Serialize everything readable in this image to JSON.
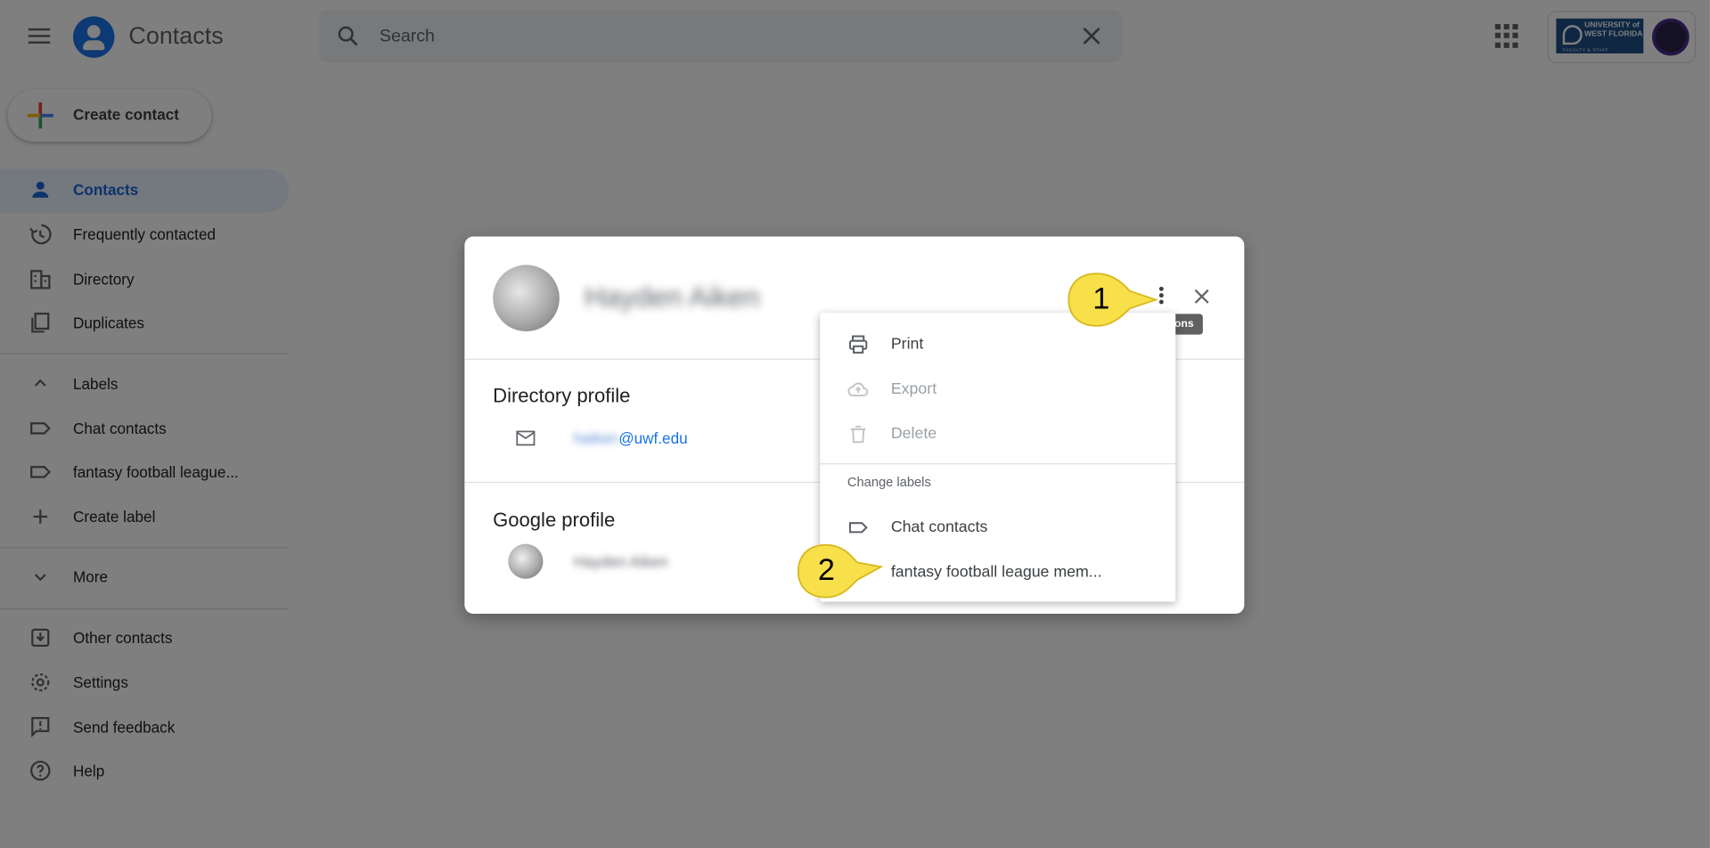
{
  "header": {
    "app_title": "Contacts",
    "search_placeholder": "Search"
  },
  "account": {
    "org_line1": "UNIVERSITY of WEST FLORIDA",
    "org_line2": "FACULTY & STAFF"
  },
  "sidebar": {
    "create_label": "Create contact",
    "items": [
      {
        "label": "Contacts",
        "icon": "person-icon",
        "active": true
      },
      {
        "label": "Frequently contacted",
        "icon": "history-icon"
      },
      {
        "label": "Directory",
        "icon": "building-icon"
      },
      {
        "label": "Duplicates",
        "icon": "duplicate-icon"
      }
    ],
    "labels_header": "Labels",
    "labels": [
      {
        "label": "Chat contacts",
        "icon": "label-icon"
      },
      {
        "label": "fantasy football league...",
        "icon": "label-icon"
      }
    ],
    "create_label_text": "Create label",
    "more_label": "More",
    "footer_items": [
      {
        "label": "Other contacts",
        "icon": "download-box-icon"
      },
      {
        "label": "Settings",
        "icon": "gear-icon"
      },
      {
        "label": "Send feedback",
        "icon": "feedback-icon"
      },
      {
        "label": "Help",
        "icon": "help-icon"
      }
    ]
  },
  "dialog": {
    "contact_name": "Hayden Aiken",
    "tooltip": "More actions",
    "directory_title": "Directory profile",
    "email_user": "haiken",
    "email_domain": "@uwf.edu",
    "google_title": "Google profile",
    "google_name": "Hayden Aiken"
  },
  "menu": {
    "items": [
      {
        "label": "Print",
        "icon": "print-icon",
        "disabled": false
      },
      {
        "label": "Export",
        "icon": "cloud-upload-icon",
        "disabled": true
      },
      {
        "label": "Delete",
        "icon": "trash-icon",
        "disabled": true
      }
    ],
    "section_label": "Change labels",
    "label_items": [
      {
        "label": "Chat contacts",
        "icon": "label-icon"
      },
      {
        "label": "fantasy football league mem..."
      }
    ]
  },
  "callouts": {
    "step1": "1",
    "step2": "2",
    "color": "#f7e04a"
  },
  "colors": {
    "accent": "#1a73e8",
    "active_bg": "#e8f0fe"
  }
}
